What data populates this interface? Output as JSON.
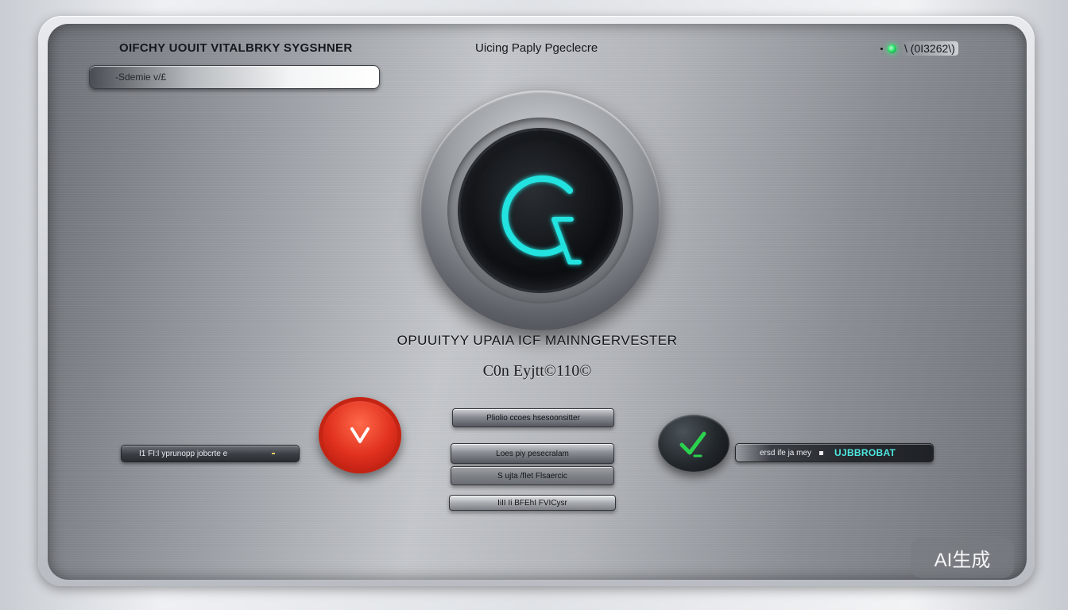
{
  "header": {
    "left_title": "OIFCHY UOUIT VITALBRKY SYGSHNER",
    "center_title": "Uicing Paply Pgeclecre",
    "status_code": "\\ (0I3262\\)"
  },
  "search": {
    "placeholder": "-Sdemie v/£"
  },
  "main": {
    "title": "OPUUITYY  UPAIA  ICF  MAINNGERVESTER",
    "subtitle": "C0n  Eyjtt©110©"
  },
  "left_panel": {
    "label": "I1  FI:I   yprunopp jobcrte  e"
  },
  "center_buttons": [
    {
      "label": "Pliolio  ccoes  hsesoonsitter"
    },
    {
      "label": "Loes  piy  pesecralam"
    },
    {
      "label": "S ujta  /fIet  Flsaercic"
    },
    {
      "label": "IiII Ii  BFEhI  FVICysr"
    }
  ],
  "right_panel": {
    "label": "ersd ife ja  mey",
    "accent_label": "UJBBROBAT"
  },
  "badge": {
    "label": "AI生成"
  },
  "colors": {
    "accent_cyan": "#22e3e0",
    "status_green": "#2de36b",
    "record_red": "#e0301e",
    "confirm_green": "#2bd14f"
  },
  "icons": {
    "dial": "c-logo-icon",
    "red_button": "chevron-down-icon",
    "green_button": "check-icon",
    "status": "status-led-icon"
  }
}
